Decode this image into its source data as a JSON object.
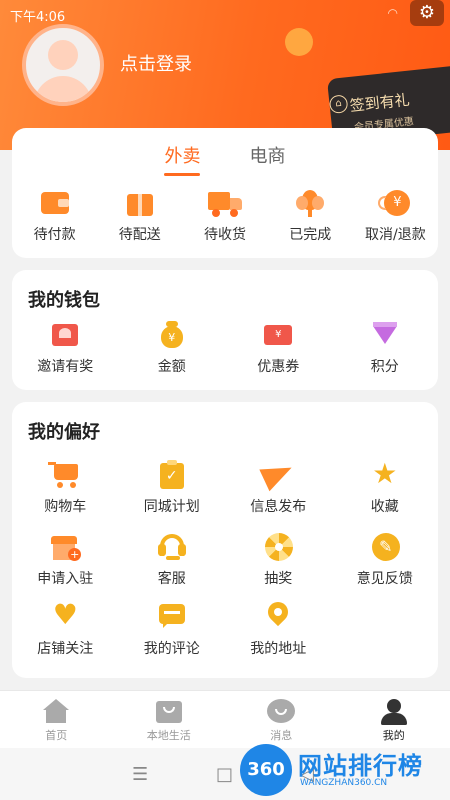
{
  "status": {
    "time": "下午4:06"
  },
  "header": {
    "login_text": "点击登录",
    "checkin_title": "签到有礼",
    "checkin_sub": "会员专属优惠"
  },
  "tabs": [
    {
      "label": "外卖",
      "active": true
    },
    {
      "label": "电商",
      "active": false
    }
  ],
  "orders": [
    {
      "label": "待付款",
      "icon": "wallet-icon"
    },
    {
      "label": "待配送",
      "icon": "package-icon"
    },
    {
      "label": "待收货",
      "icon": "truck-icon"
    },
    {
      "label": "已完成",
      "icon": "flower-icon"
    },
    {
      "label": "取消/退款",
      "icon": "yen-coin-icon"
    }
  ],
  "wallet": {
    "title": "我的钱包",
    "items": [
      {
        "label": "邀请有奖",
        "icon": "envelope-icon"
      },
      {
        "label": "金额",
        "icon": "money-bag-icon"
      },
      {
        "label": "优惠券",
        "icon": "coupon-icon"
      },
      {
        "label": "积分",
        "icon": "diamond-icon"
      }
    ]
  },
  "prefs": {
    "title": "我的偏好",
    "rows": [
      [
        {
          "label": "购物车",
          "icon": "cart-icon"
        },
        {
          "label": "同城计划",
          "icon": "clipboard-icon"
        },
        {
          "label": "信息发布",
          "icon": "paper-plane-icon"
        },
        {
          "label": "收藏",
          "icon": "star-icon"
        }
      ],
      [
        {
          "label": "申请入驻",
          "icon": "store-icon"
        },
        {
          "label": "客服",
          "icon": "headset-icon"
        },
        {
          "label": "抽奖",
          "icon": "wheel-icon"
        },
        {
          "label": "意见反馈",
          "icon": "pencil-icon"
        }
      ],
      [
        {
          "label": "店铺关注",
          "icon": "heart-icon"
        },
        {
          "label": "我的评论",
          "icon": "comment-icon"
        },
        {
          "label": "我的地址",
          "icon": "location-icon"
        }
      ]
    ]
  },
  "nav": [
    {
      "label": "首页",
      "icon": "home-icon",
      "active": false
    },
    {
      "label": "本地生活",
      "icon": "bag-icon",
      "active": false
    },
    {
      "label": "消息",
      "icon": "chat-icon",
      "active": false
    },
    {
      "label": "我的",
      "icon": "person-icon",
      "active": true
    }
  ],
  "system_nav": {
    "menu": "☰",
    "home": "□",
    "back": "◁"
  },
  "watermark": {
    "logo": "360",
    "name": "网站排行榜",
    "url": "WANGZHAN360.CN"
  },
  "colors": {
    "accent": "#ff6a1f",
    "icon_orange": "#ff8a2a",
    "icon_gold": "#f5b21f",
    "icon_red": "#f0574a",
    "icon_purple": "#c56be0"
  }
}
